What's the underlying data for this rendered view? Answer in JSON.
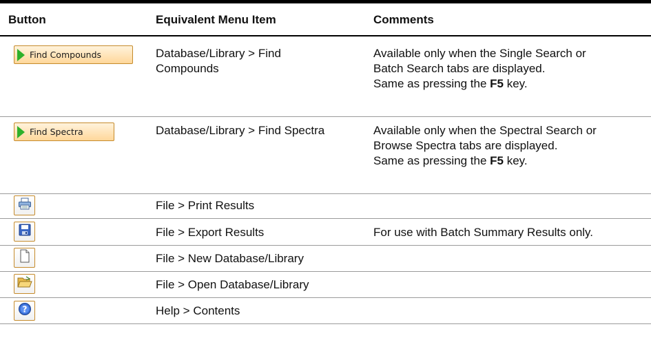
{
  "headers": {
    "button": "Button",
    "menu": "Equivalent Menu Item",
    "comments": "Comments"
  },
  "rows": [
    {
      "button_label": "Find Compounds",
      "button_icon": "play-icon",
      "menu_lines": [
        "Database/Library > Find",
        "Compounds"
      ],
      "comment_lines": [
        "Available only when the Single Search or",
        "Batch Search tabs are displayed."
      ],
      "comment_key_prefix": "Same as pressing the ",
      "comment_key": "F5",
      "comment_key_suffix": " key."
    },
    {
      "button_label": "Find Spectra",
      "button_icon": "play-icon",
      "menu_lines": [
        "Database/Library > Find Spectra"
      ],
      "comment_lines": [
        "Available only when the Spectral Search or",
        "Browse Spectra tabs are displayed."
      ],
      "comment_key_prefix": "Same as pressing the ",
      "comment_key": "F5",
      "comment_key_suffix": " key."
    },
    {
      "button_icon": "printer-icon",
      "menu": "File > Print Results",
      "comment": ""
    },
    {
      "button_icon": "save-icon",
      "menu": "File > Export Results",
      "comment": "For use with Batch Summary Results only."
    },
    {
      "button_icon": "new-document-icon",
      "menu": "File > New Database/Library",
      "comment": ""
    },
    {
      "button_icon": "open-folder-icon",
      "menu": "File > Open Database/Library",
      "comment": ""
    },
    {
      "button_icon": "help-icon",
      "menu": "Help > Contents",
      "comment": ""
    }
  ]
}
